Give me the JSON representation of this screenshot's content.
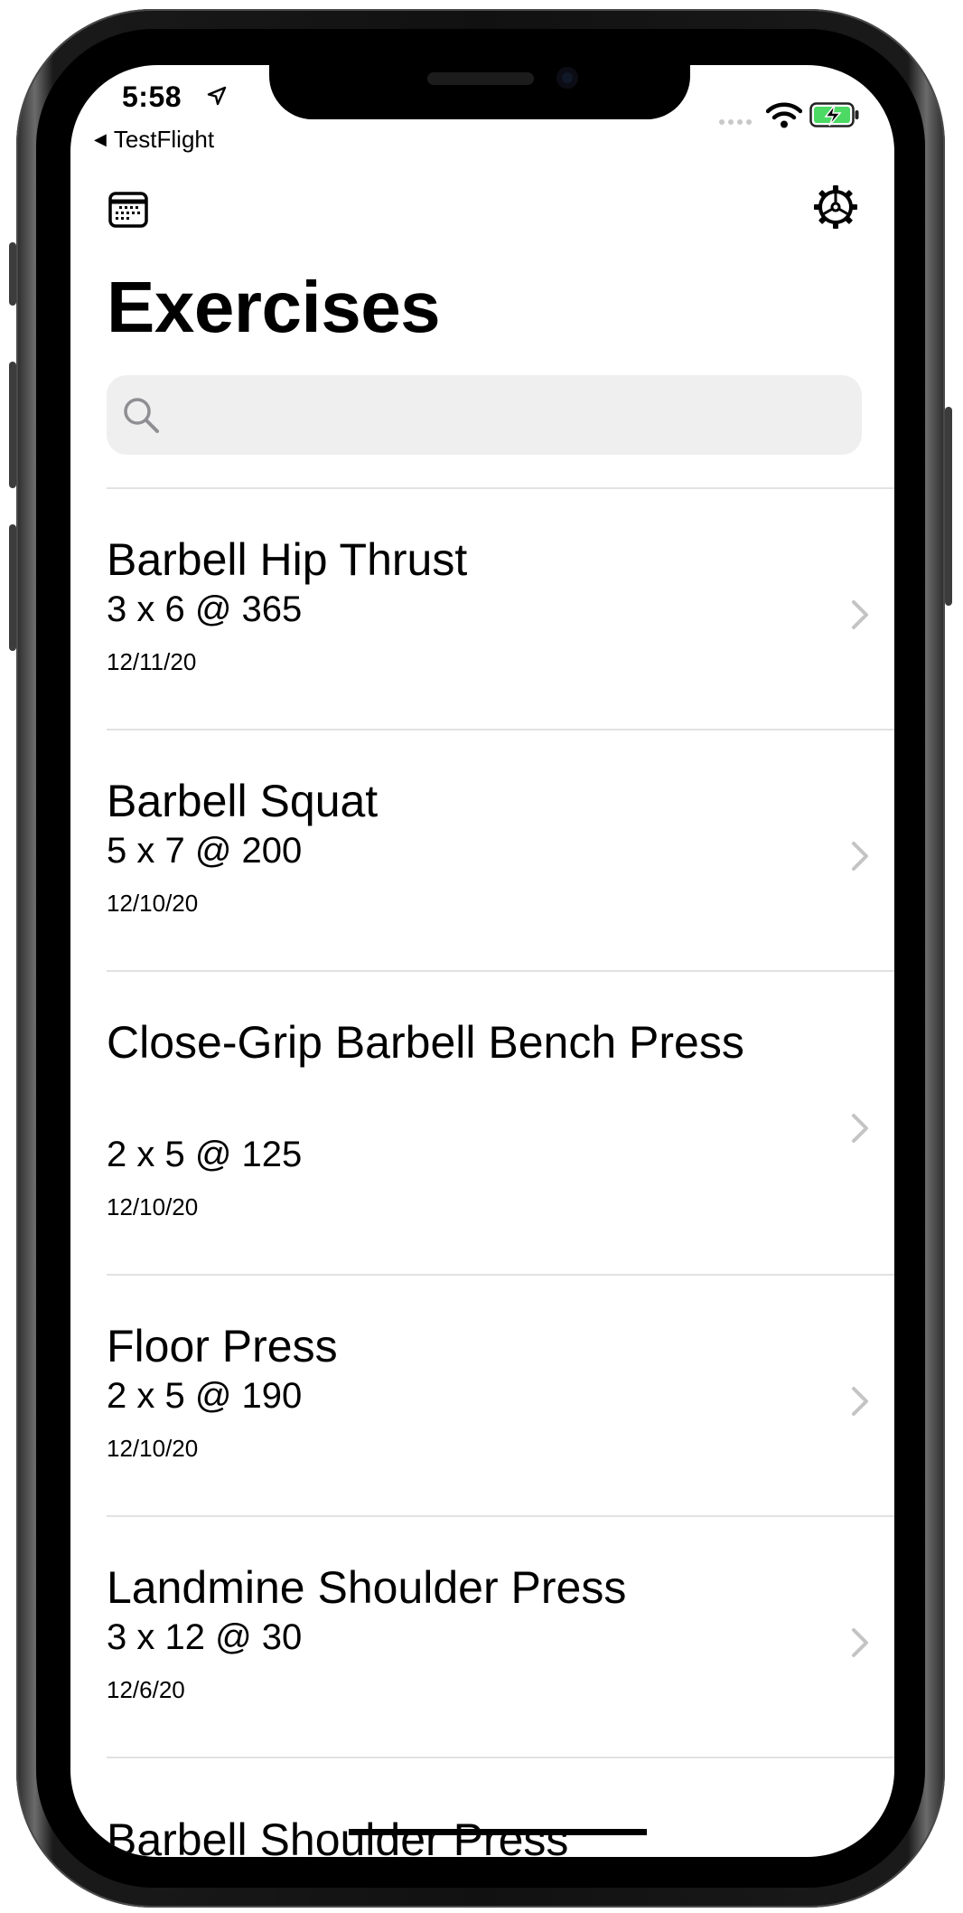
{
  "status_bar": {
    "time": "5:58",
    "back_app": "TestFlight"
  },
  "nav": {
    "calendar_icon": "calendar-icon",
    "settings_icon": "gear-icon"
  },
  "page": {
    "title": "Exercises"
  },
  "search": {
    "placeholder": "",
    "value": ""
  },
  "exercises": [
    {
      "name": "Barbell Hip Thrust",
      "detail": "3 x 6 @ 365",
      "date": "12/11/20"
    },
    {
      "name": "Barbell Squat",
      "detail": "5 x 7 @ 200",
      "date": "12/10/20"
    },
    {
      "name": "Close-Grip Barbell Bench Press",
      "detail": "2 x 5 @ 125",
      "date": "12/10/20"
    },
    {
      "name": "Floor Press",
      "detail": "2 x 5 @ 190",
      "date": "12/10/20"
    },
    {
      "name": "Landmine Shoulder Press",
      "detail": "3 x 12 @ 30",
      "date": "12/6/20"
    },
    {
      "name": "Barbell Shoulder Press"
    }
  ],
  "colors": {
    "search_bg": "#efefef",
    "divider": "#e2e2e2",
    "chevron": "#c4c4c4",
    "battery": "#4cd964"
  }
}
